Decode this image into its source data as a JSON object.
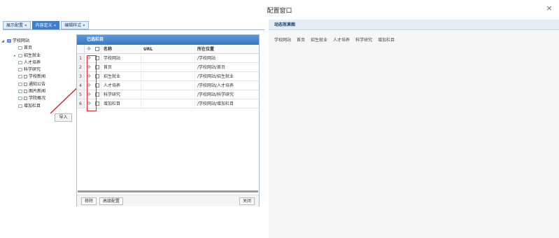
{
  "window": {
    "title": "配置窗口",
    "close_glyph": "×"
  },
  "tabs": [
    {
      "label": "展示配置 «"
    },
    {
      "label": "内容定义 «"
    },
    {
      "label": "编辑样式 «"
    }
  ],
  "tree": {
    "root": "学校网站",
    "items": [
      "首页",
      "招生就业",
      "人才培养",
      "科学研究",
      "学校新闻",
      "通知公告",
      "图片新闻",
      "学院概况",
      "增加栏目"
    ],
    "expand_glyph": "▸",
    "collapse_glyph": "◢"
  },
  "import_button": "导入",
  "panel": {
    "title": "已选栏目",
    "columns": {
      "name": "名称",
      "url": "URL",
      "location": "所在位置"
    },
    "rows": [
      {
        "num": "1",
        "name": "学校网站",
        "url": "",
        "location": "/学校网站"
      },
      {
        "num": "2",
        "name": "首页",
        "url": "",
        "location": "/学校网站/首页"
      },
      {
        "num": "3",
        "name": "招生就业",
        "url": "",
        "location": "/学校网站/招生就业"
      },
      {
        "num": "4",
        "name": "人才培养",
        "url": "",
        "location": "/学校网站/人才培养"
      },
      {
        "num": "5",
        "name": "科学研究",
        "url": "",
        "location": "/学校网站/科学研究"
      },
      {
        "num": "6",
        "name": "增加栏目",
        "url": "",
        "location": "/学校网站/增加栏目"
      }
    ],
    "move_glyph": "✥",
    "footer": {
      "remove": "移除",
      "advanced": "高级配置",
      "close": "关闭"
    }
  },
  "preview": {
    "title": "动态效果图",
    "nav": [
      "学校网站",
      "首页",
      "招生就业",
      "人才培养",
      "科学研究",
      "增加栏目"
    ]
  },
  "colors": {
    "accent": "#3d7fc9",
    "annotation": "#e02828"
  }
}
